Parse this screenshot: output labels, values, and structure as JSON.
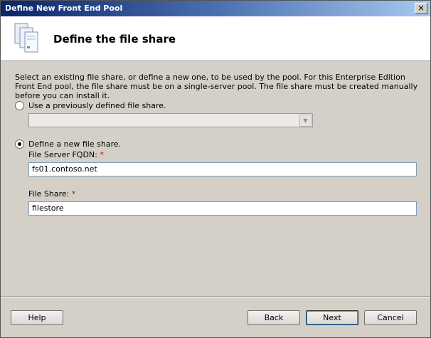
{
  "window": {
    "title": "Define New Front End Pool",
    "close_glyph": "×"
  },
  "header": {
    "title": "Define the file share",
    "icon": "file-share-icon"
  },
  "intro_text": "Select an existing file share, or define a new one, to be used by the pool. For this Enterprise Edition Front End pool, the file share must be on a single-server pool.  The file share must be created manually before you can install it.",
  "options": {
    "existing_label": "Use a previously defined file share.",
    "existing_selected": false,
    "existing_combo_value": "",
    "new_label": "Define a new file share.",
    "new_selected": true
  },
  "fields": {
    "fqdn_label": "File Server FQDN:",
    "fqdn_value": "fs01.contoso.net",
    "share_label": "File Share:",
    "share_value": "filestore",
    "required_marker": "*"
  },
  "buttons": {
    "help": "Help",
    "back": "Back",
    "next": "Next",
    "cancel": "Cancel"
  },
  "colors": {
    "required": "#d40000",
    "titlebar_start": "#0a246a"
  }
}
